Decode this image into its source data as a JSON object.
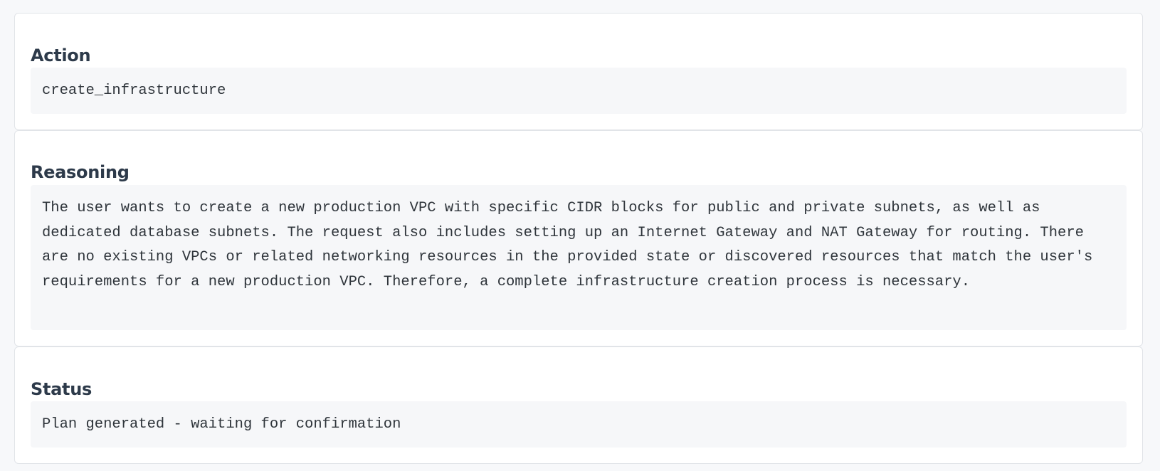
{
  "sections": [
    {
      "heading": "Action",
      "content": "create_infrastructure"
    },
    {
      "heading": "Reasoning",
      "content": "The user wants to create a new production VPC with specific CIDR blocks for public and private subnets, as well as dedicated database subnets. The request also includes setting up an Internet Gateway and NAT Gateway for routing. There are no existing VPCs or related networking resources in the provided state or discovered resources that match the user's requirements for a new production VPC. Therefore, a complete infrastructure creation process is necessary."
    },
    {
      "heading": "Status",
      "content": "Plan generated - waiting for confirmation"
    }
  ]
}
